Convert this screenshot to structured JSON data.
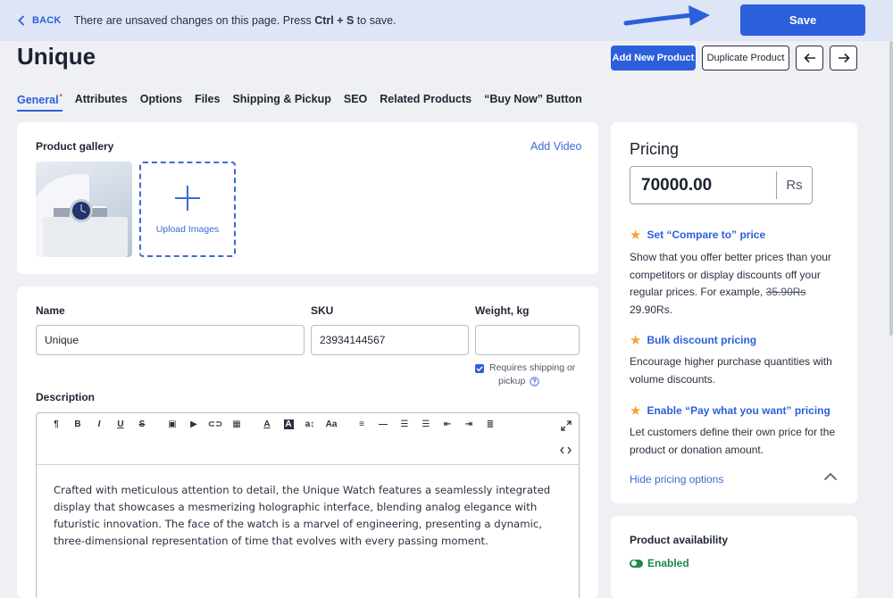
{
  "topbar": {
    "back_label": "BACK",
    "unsaved_prefix": "There are unsaved changes on this page. Press ",
    "unsaved_shortcut": "Ctrl + S",
    "unsaved_suffix": " to save.",
    "save_label": "Save"
  },
  "header": {
    "title": "Unique",
    "add_new_label": "Add New Product",
    "duplicate_label": "Duplicate Product"
  },
  "tabs": [
    {
      "label": "General",
      "active": true,
      "marker": "*"
    },
    {
      "label": "Attributes"
    },
    {
      "label": "Options"
    },
    {
      "label": "Files"
    },
    {
      "label": "Shipping & Pickup"
    },
    {
      "label": "SEO"
    },
    {
      "label": "Related Products"
    },
    {
      "label": "“Buy Now” Button"
    }
  ],
  "gallery": {
    "title": "Product gallery",
    "add_video": "Add Video",
    "upload_label": "Upload Images"
  },
  "details": {
    "name_label": "Name",
    "name_value": "Unique",
    "sku_label": "SKU",
    "sku_value": "23934144567",
    "weight_label": "Weight, kg",
    "weight_value": "",
    "requires_shipping_line1": "Requires shipping or",
    "requires_shipping_line2": "pickup",
    "description_label": "Description",
    "description_text": "Crafted with meticulous attention to detail, the Unique Watch features a seamlessly integrated display that showcases a mesmerizing holographic interface, blending analog elegance with futuristic innovation. The face of the watch is a marvel of engineering, presenting a dynamic, three-dimensional representation of time that evolves with every passing moment."
  },
  "pricing": {
    "title": "Pricing",
    "price": "70000.00",
    "currency": "Rs",
    "compare_title": "Set “Compare to” price",
    "compare_text_pre": "Show that you offer better prices than your competitors or display discounts off your regular prices. For example, ",
    "compare_old": "35.90Rs",
    "compare_new": " 29.90Rs.",
    "bulk_title": "Bulk discount pricing",
    "bulk_text": "Encourage higher purchase quantities with volume discounts.",
    "pwyw_title": "Enable “Pay what you want” pricing",
    "pwyw_text": "Let customers define their own price for the product or donation amount.",
    "hide_options": "Hide pricing options"
  },
  "availability": {
    "title": "Product availability",
    "status": "Enabled"
  },
  "colors": {
    "accent": "#2c5fdb",
    "enabled_green": "#1d8a47",
    "star": "#f2a33a"
  }
}
